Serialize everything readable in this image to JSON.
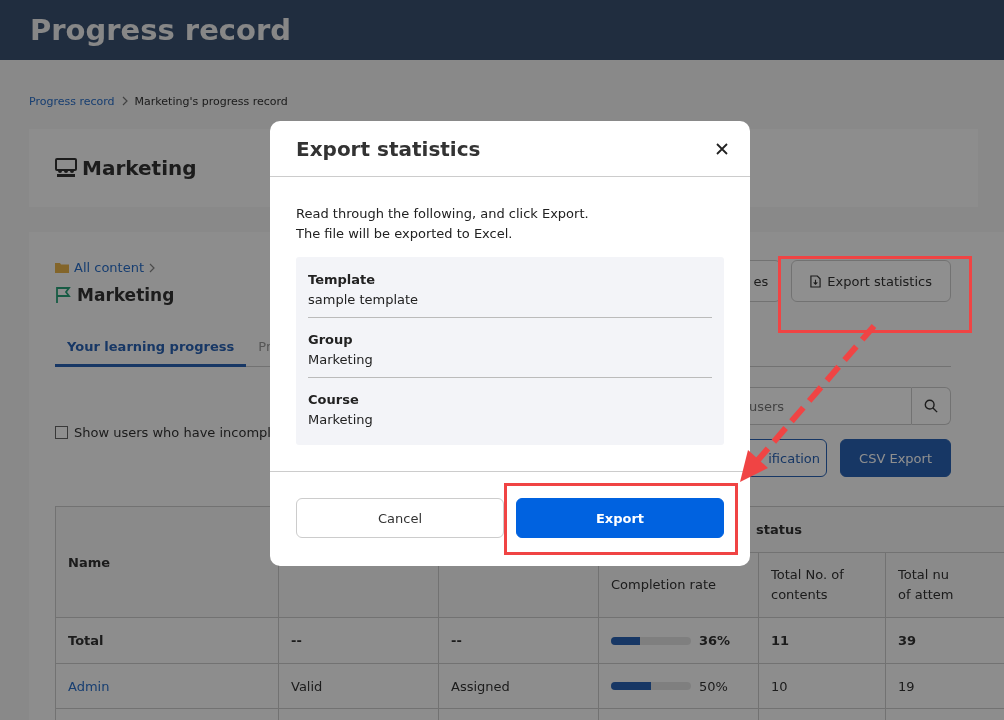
{
  "header": {
    "title": "Progress record"
  },
  "breadcrumb": [
    {
      "label": "Progress record",
      "kind": "link"
    },
    {
      "label": "Marketing's progress record",
      "kind": "current"
    }
  ],
  "group_card": {
    "title": "Marketing"
  },
  "content": {
    "path": "All content",
    "title": "Marketing"
  },
  "actions": [
    {
      "label": "es",
      "kind": "plain"
    },
    {
      "label": "Export statistics",
      "kind": "export"
    }
  ],
  "tabs": [
    {
      "label": "Your learning progress",
      "selected": true
    },
    {
      "label": "Pr",
      "selected": false
    }
  ],
  "search": {
    "placeholder": "users"
  },
  "filter": {
    "label": "Show users who have incompl",
    "checked": false
  },
  "table_buttons": [
    {
      "label": "ification",
      "kind": "outline"
    },
    {
      "label": "CSV Export",
      "kind": "primary"
    }
  ],
  "table": {
    "group_header": "status",
    "columns": [
      "Name",
      "Completion rate",
      "Total No. of contents",
      "Total nu\nof attem"
    ],
    "rows": [
      {
        "kind": "total",
        "name": "Total",
        "status": "--",
        "assignment": "--",
        "level": 0.36,
        "rate": "36%",
        "contents": "11",
        "attempts": "39"
      },
      {
        "kind": "user",
        "name": "Admin",
        "status": "Valid",
        "assignment": "Assigned",
        "level": 0.5,
        "rate": "50%",
        "contents": "10",
        "attempts": "19"
      }
    ]
  },
  "modal": {
    "title": "Export statistics",
    "text": [
      "Read through the following, and click Export.",
      "The file will be exported to Excel."
    ],
    "fields": [
      {
        "label": "Template",
        "value": "sample template"
      },
      {
        "label": "Group",
        "value": "Marketing"
      },
      {
        "label": "Course",
        "value": "Marketing"
      }
    ],
    "buttons": [
      {
        "label": "Cancel",
        "kind": "secondary"
      },
      {
        "label": "Export",
        "kind": "primary"
      }
    ]
  }
}
